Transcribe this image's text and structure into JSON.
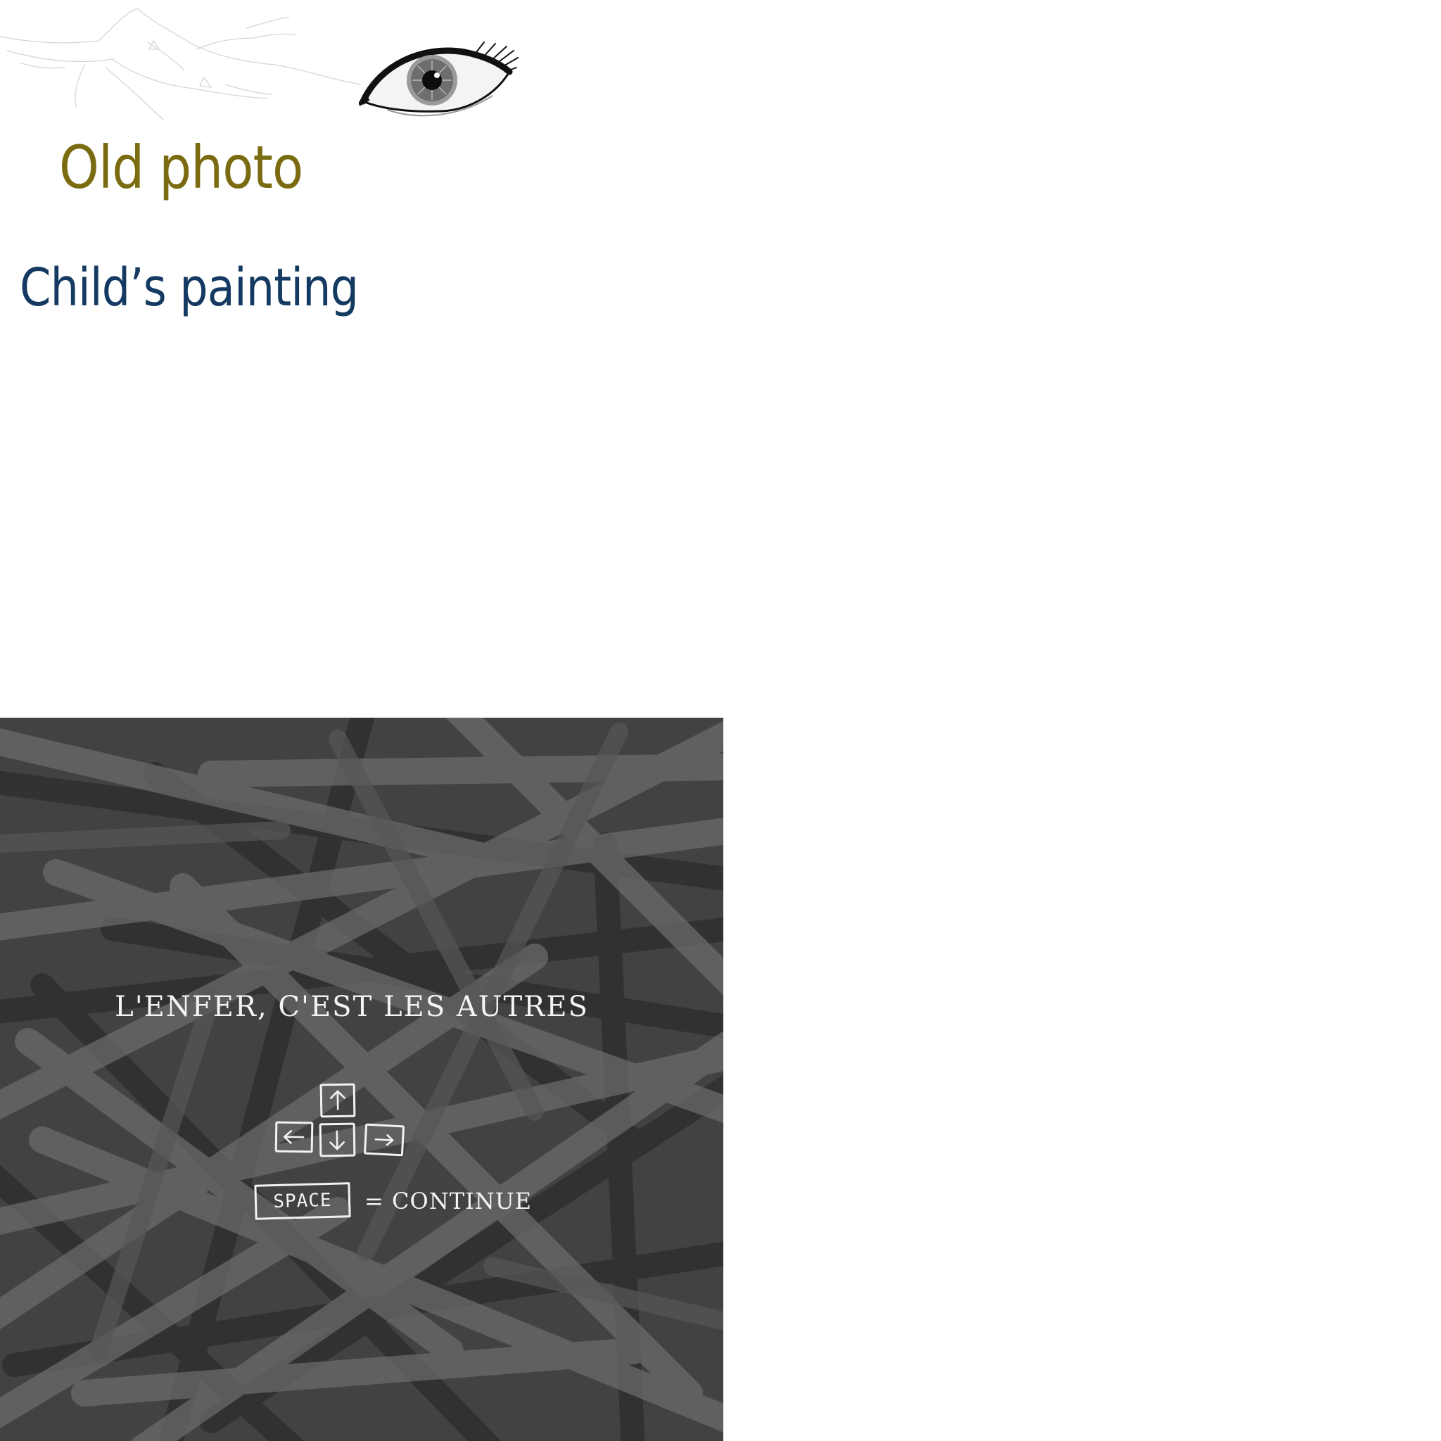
{
  "labels": {
    "old_photo": "Old photo",
    "childs_painting": "Child’s painting"
  },
  "game": {
    "title": "L'ENFER, C'EST LES AUTRES",
    "controls": {
      "up_key": "up-arrow-icon",
      "left_key": "left-arrow-icon",
      "down_key": "down-arrow-icon",
      "right_key": "right-arrow-icon",
      "space_key_label": "SPACE",
      "continue_text": "= CONTINUE"
    }
  },
  "colors": {
    "old_photo_label": "#7a6a10",
    "childs_painting_label": "#143a62",
    "panel_background": "#424242",
    "panel_text": "#f4f4f4"
  }
}
